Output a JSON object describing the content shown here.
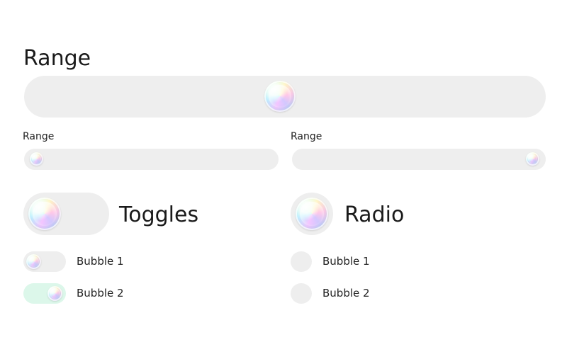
{
  "range_section": {
    "title": "Range",
    "main_slider": {
      "value": 0.5
    },
    "sliders": [
      {
        "label": "Range",
        "value": 0.0
      },
      {
        "label": "Range",
        "value": 1.0
      }
    ]
  },
  "toggles_section": {
    "title": "Toggles",
    "main_toggle_on": false,
    "items": [
      {
        "label": "Bubble 1",
        "on": false
      },
      {
        "label": "Bubble 2",
        "on": true
      }
    ],
    "on_color": "#dcf7ea"
  },
  "radio_section": {
    "title": "Radio",
    "items": [
      {
        "label": "Bubble 1",
        "selected": false
      },
      {
        "label": "Bubble 2",
        "selected": false
      }
    ]
  },
  "colors": {
    "track": "#eeeeee",
    "background": "#ffffff"
  }
}
